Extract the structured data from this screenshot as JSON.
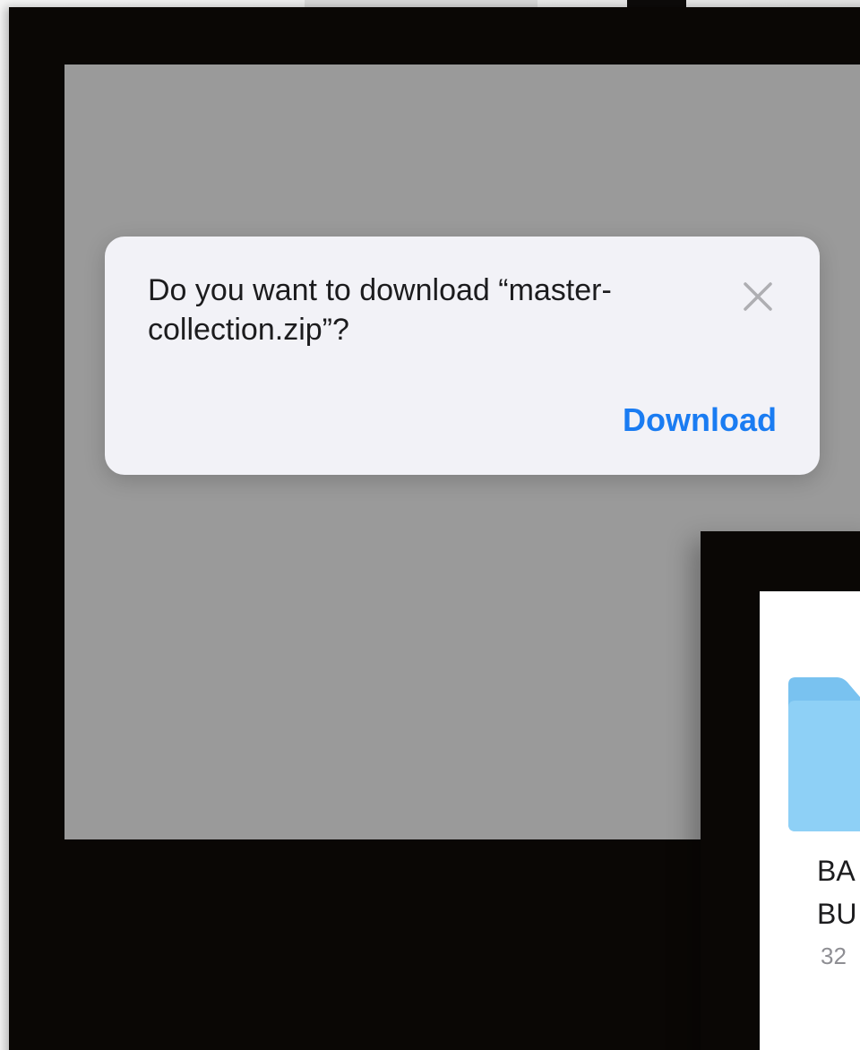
{
  "dialog": {
    "message": "Do you want to download “master-collection.zip”?",
    "close_icon": "close-icon",
    "download_label": "Download",
    "accent_color": "#1a7cf2"
  },
  "file_card": {
    "icon": "folder-icon",
    "name_line_1": "BA",
    "name_line_2": "BU",
    "size_partial": "32"
  }
}
